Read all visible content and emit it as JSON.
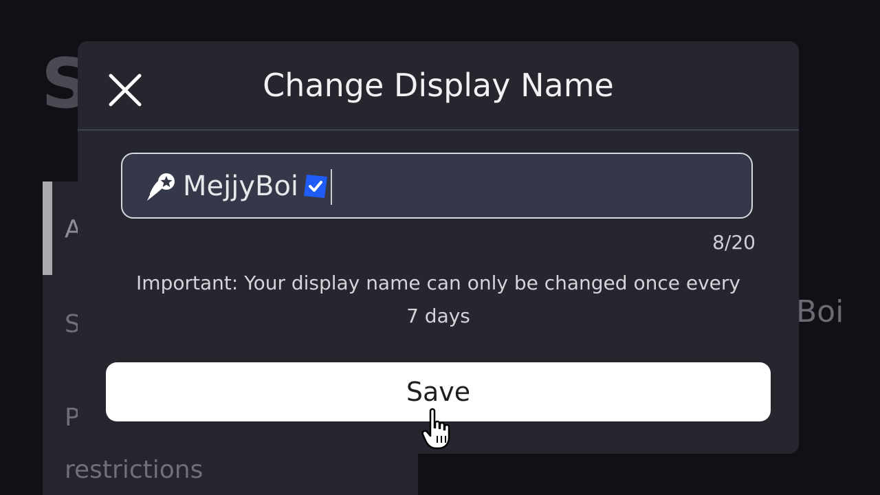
{
  "background": {
    "page_title_fragment": "S",
    "sidebar": {
      "items": [
        {
          "label": "A"
        },
        {
          "label": "S"
        },
        {
          "label": "P"
        },
        {
          "label": "restrictions"
        }
      ]
    },
    "right_text_fragment": "Boi"
  },
  "modal": {
    "title": "Change Display Name",
    "close_icon": "close-icon",
    "input": {
      "prefix_icon": "rocket-star-icon",
      "value": "MejjyBoi",
      "suffix_icon": "verified-check-icon",
      "char_count": "8/20"
    },
    "notice": "Important: Your display name can only be changed once every 7 days",
    "save_label": "Save"
  },
  "colors": {
    "modal_bg": "#25262e",
    "input_bg": "#353848",
    "verified_blue": "#1f5cf5",
    "save_bg": "#ffffff"
  }
}
